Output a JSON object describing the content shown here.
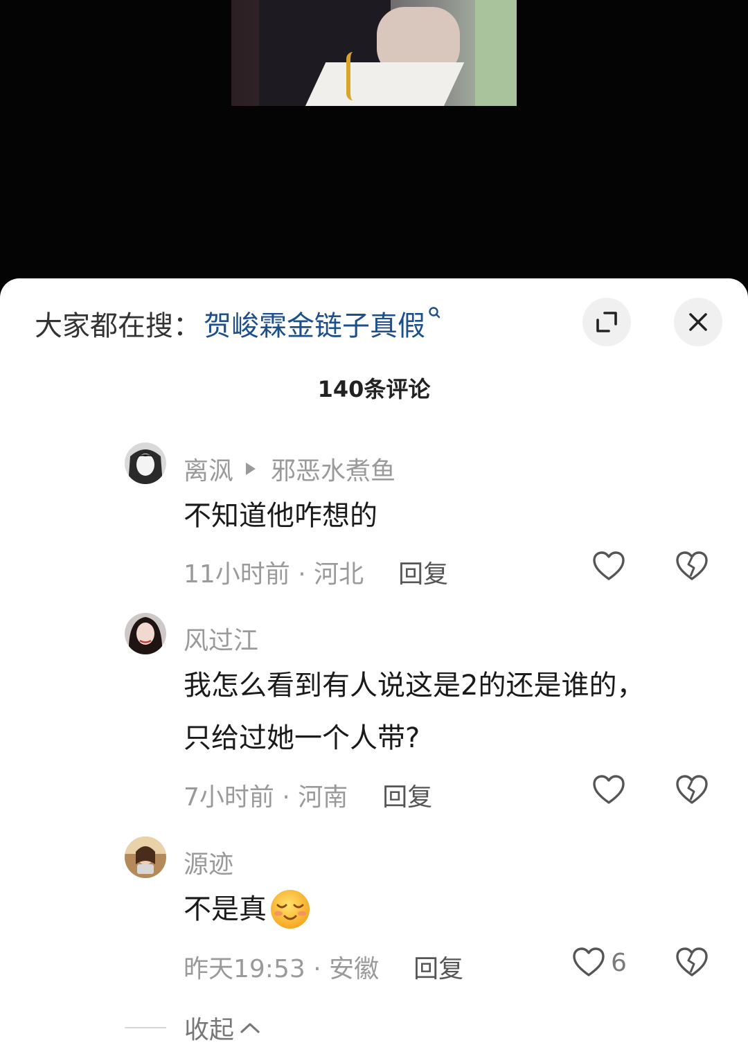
{
  "sheet": {
    "search_prefix": "大家都在搜：",
    "search_term": "贺峻霖金链子真假",
    "comment_count": "140条评论"
  },
  "replies": [
    {
      "username": "离沨",
      "reply_to": "邪恶水煮鱼",
      "text": "不知道他咋想的",
      "time_location": "11小时前 · 河北",
      "reply_label": "回复",
      "likes": ""
    },
    {
      "username": "风过江",
      "reply_to": "",
      "text_line1": "我怎么看到有人说这是2的还是谁的，",
      "text_line2": "只给过她一个人带?",
      "time_location": "7小时前 · 河南",
      "reply_label": "回复",
      "likes": ""
    },
    {
      "username": "源迹",
      "reply_to": "",
      "text": "不是真",
      "time_location": "昨天19:53 · 安徽",
      "reply_label": "回复",
      "likes": "6"
    }
  ],
  "collapse_label": "收起",
  "colors": {
    "search_term": "#1d4f8c",
    "muted_text": "#9a9a9a",
    "background_dark": "#040404"
  },
  "icons": [
    "magnifier-icon",
    "expand-icon",
    "close-icon",
    "heart-icon",
    "broken-heart-icon",
    "chevron-up-icon",
    "smiling-emoji-icon"
  ]
}
